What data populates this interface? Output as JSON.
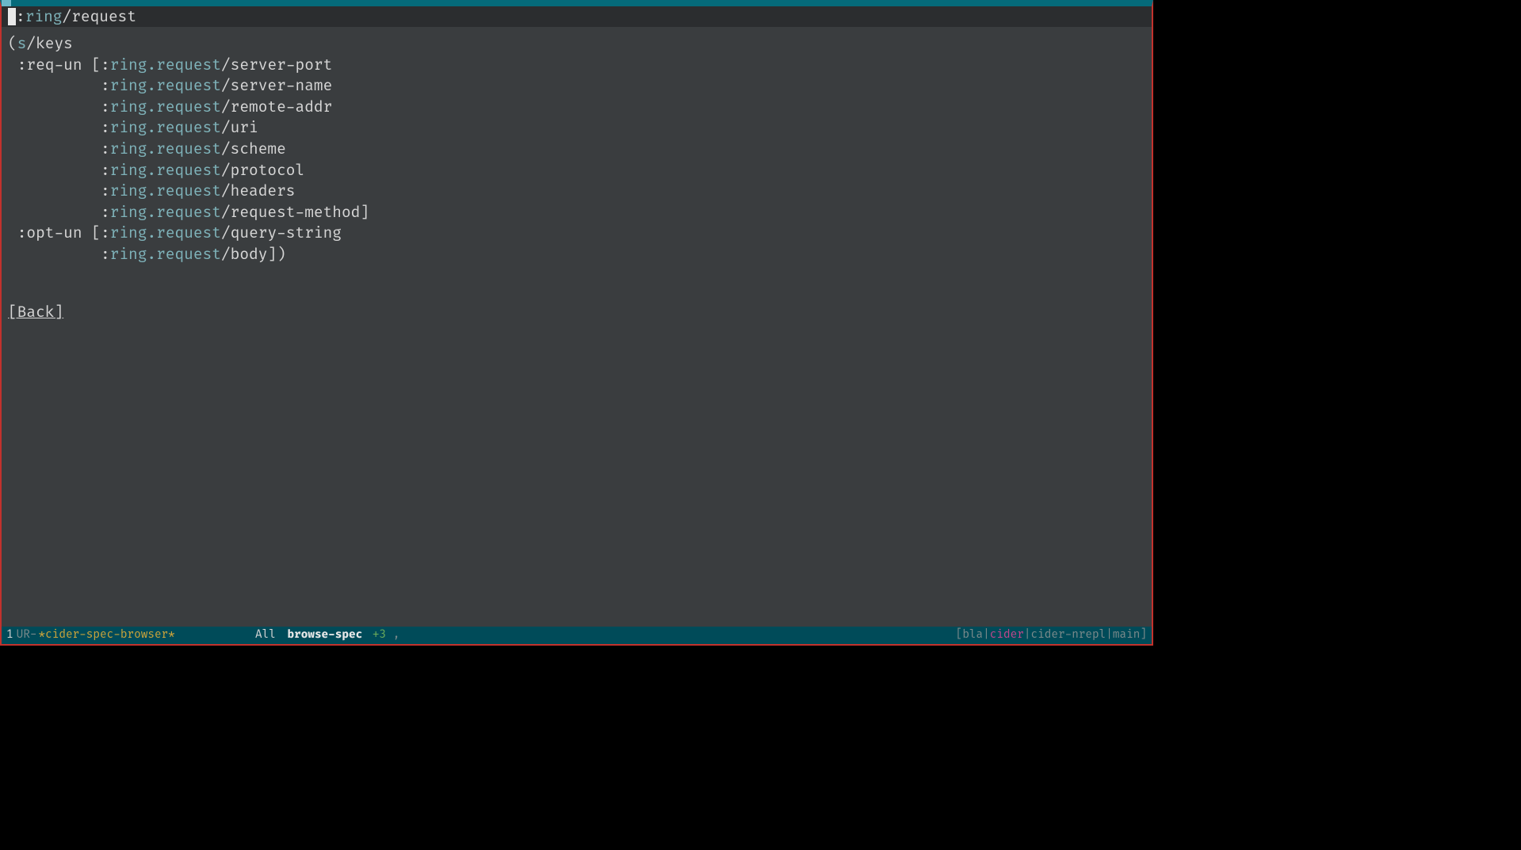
{
  "header": {
    "colon": ":",
    "ns": "ring",
    "slash": "/",
    "name": "request"
  },
  "spec": {
    "open": "(",
    "s_keys_ns": "s",
    "s_keys_slash": "/",
    "s_keys_name": "keys",
    "req_kw": ":req-un",
    "opt_kw": ":opt-un",
    "req": [
      {
        "ns": "ring.request",
        "name": "server-port"
      },
      {
        "ns": "ring.request",
        "name": "server-name"
      },
      {
        "ns": "ring.request",
        "name": "remote-addr"
      },
      {
        "ns": "ring.request",
        "name": "uri"
      },
      {
        "ns": "ring.request",
        "name": "scheme"
      },
      {
        "ns": "ring.request",
        "name": "protocol"
      },
      {
        "ns": "ring.request",
        "name": "headers"
      },
      {
        "ns": "ring.request",
        "name": "request-method"
      }
    ],
    "opt": [
      {
        "ns": "ring.request",
        "name": "query-string"
      },
      {
        "ns": "ring.request",
        "name": "body"
      }
    ]
  },
  "back_label": "[Back]",
  "modeline": {
    "bufnum": "1",
    "modflags": "UR-",
    "bufname": "*cider-spec-browser*",
    "position": "All",
    "mode": "browse-spec",
    "plus": "+3",
    "comma": " ,",
    "right_open": "[",
    "r1": "bla",
    "sep": "|",
    "r2": "cider",
    "r3": "cider-nrepl",
    "r4": "main",
    "right_close": "]"
  }
}
